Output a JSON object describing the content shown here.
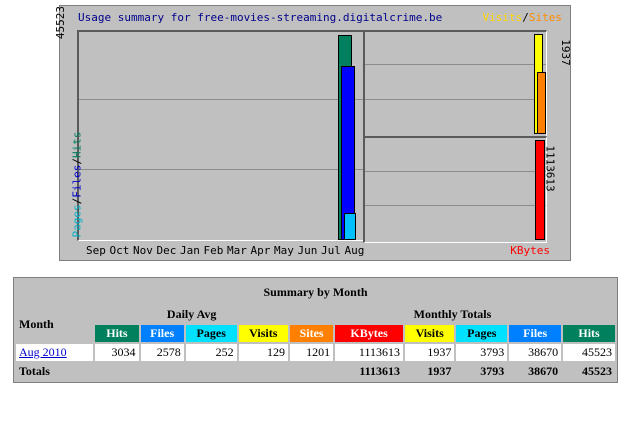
{
  "graph": {
    "title": "Usage summary for free-movies-streaming.digitalcrime.be",
    "legend_right": {
      "visits": "Visits",
      "sep": "/",
      "sites": "Sites"
    },
    "legend_left": {
      "pages": "Pages",
      "sep1": "/",
      "files": "Files",
      "sep2": "/",
      "hits": "Hits"
    },
    "y_max_hits": "45523",
    "y_max_visits": "1937",
    "y_max_kbytes": "1113613",
    "kbytes_label": "KBytes",
    "months": [
      "Sep",
      "Oct",
      "Nov",
      "Dec",
      "Jan",
      "Feb",
      "Mar",
      "Apr",
      "May",
      "Jun",
      "Jul",
      "Aug"
    ],
    "colors": {
      "hits": "#00805c",
      "files": "#0000ff",
      "pages": "#00c0ff",
      "visits": "#ffff00",
      "sites": "#ff8000",
      "kbytes": "#ff0000"
    }
  },
  "chart_data": {
    "type": "bar",
    "categories": [
      "Sep",
      "Oct",
      "Nov",
      "Dec",
      "Jan",
      "Feb",
      "Mar",
      "Apr",
      "May",
      "Jun",
      "Jul",
      "Aug"
    ],
    "series": [
      {
        "name": "Hits",
        "values": [
          0,
          0,
          0,
          0,
          0,
          0,
          0,
          0,
          0,
          0,
          0,
          45523
        ]
      },
      {
        "name": "Files",
        "values": [
          0,
          0,
          0,
          0,
          0,
          0,
          0,
          0,
          0,
          0,
          0,
          38670
        ]
      },
      {
        "name": "Pages",
        "values": [
          0,
          0,
          0,
          0,
          0,
          0,
          0,
          0,
          0,
          0,
          0,
          3793
        ]
      },
      {
        "name": "Visits",
        "values": [
          0,
          0,
          0,
          0,
          0,
          0,
          0,
          0,
          0,
          0,
          0,
          1937
        ]
      },
      {
        "name": "Sites",
        "values": [
          0,
          0,
          0,
          0,
          0,
          0,
          0,
          0,
          0,
          0,
          0,
          1201
        ]
      },
      {
        "name": "KBytes",
        "values": [
          0,
          0,
          0,
          0,
          0,
          0,
          0,
          0,
          0,
          0,
          0,
          1113613
        ]
      }
    ]
  },
  "summary": {
    "title": "Summary by Month",
    "month_header": "Month",
    "daily_avg": "Daily Avg",
    "monthly_totals": "Monthly Totals",
    "cols": {
      "hits": "Hits",
      "files": "Files",
      "pages": "Pages",
      "visits": "Visits",
      "sites": "Sites",
      "kbytes": "KBytes"
    },
    "row": {
      "month": "Aug 2010",
      "avg_hits": "3034",
      "avg_files": "2578",
      "avg_pages": "252",
      "avg_visits": "129",
      "sites": "1201",
      "kbytes": "1113613",
      "visits": "1937",
      "pages": "3793",
      "files": "38670",
      "hits": "45523"
    },
    "totals": {
      "label": "Totals",
      "kbytes": "1113613",
      "visits": "1937",
      "pages": "3793",
      "files": "38670",
      "hits": "45523"
    }
  }
}
